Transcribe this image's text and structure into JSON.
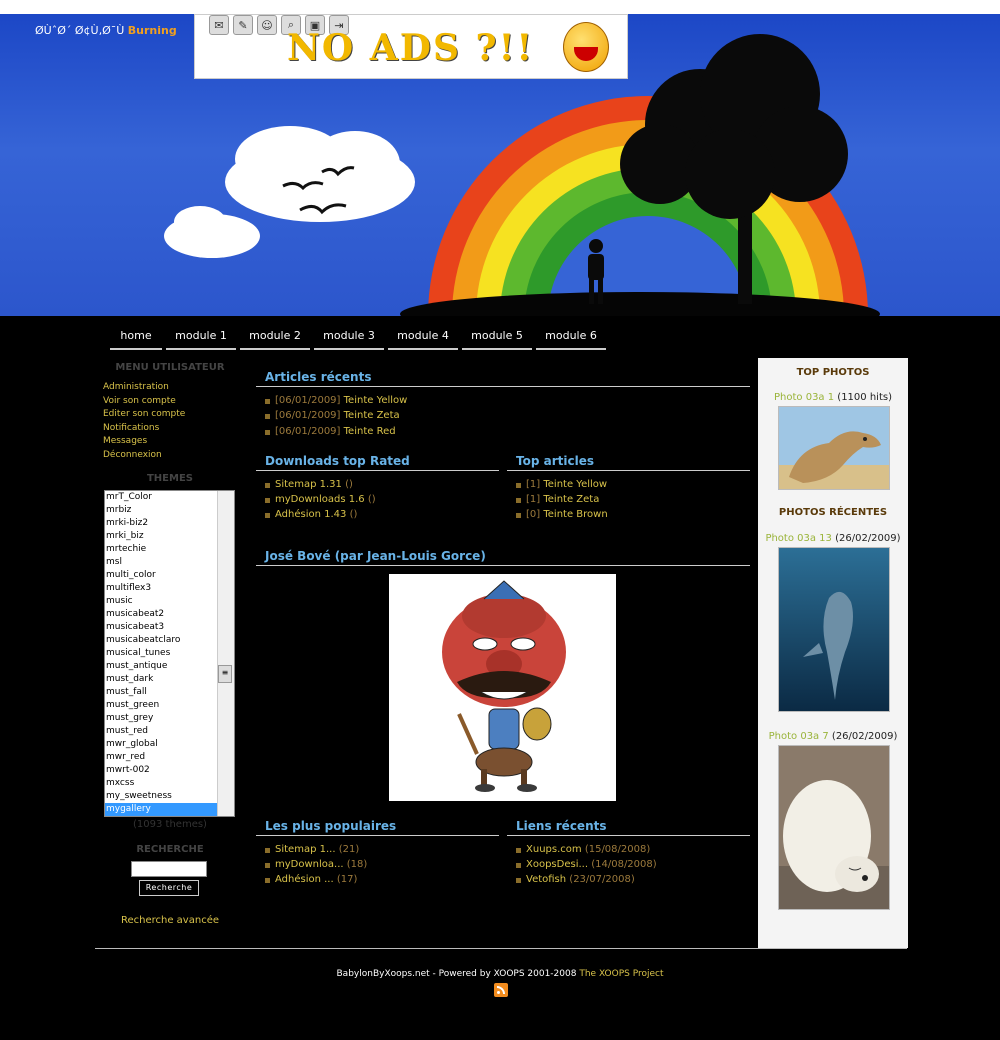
{
  "header": {
    "site_title": "ØÙˆØ´ØªÙ…ØˆÙˆØ¯ Burning",
    "site_title_prefix": "ØÙˆØ´ Ø¢Ù‚Ø¯Ù",
    "site_title_accent": "Burning",
    "ad_text": "NO ADS ?!!"
  },
  "nav": [
    "home",
    "module 1",
    "module 2",
    "module 3",
    "module 4",
    "module 5",
    "module 6"
  ],
  "left": {
    "user_menu_title": "MENU UTILISATEUR",
    "user_menu": [
      "Administration",
      "Voir son compte",
      "Editer son compte",
      "Notifications",
      "Messages",
      "Déconnexion"
    ],
    "themes_title": "THEMES",
    "themes": [
      "mrT_Color",
      "mrbiz",
      "mrki-biz2",
      "mrki_biz",
      "mrtechie",
      "msl",
      "multi_color",
      "multiflex3",
      "music",
      "musicabeat2",
      "musicabeat3",
      "musicabeatclaro",
      "musical_tunes",
      "must_antique",
      "must_dark",
      "must_fall",
      "must_green",
      "must_grey",
      "must_red",
      "mwr_global",
      "mwr_red",
      "mwrt-002",
      "mxcss",
      "my_sweetness",
      "mygallery"
    ],
    "selected_theme": "mygallery",
    "theme_count": "(1093 themes)",
    "search_title": "RECHERCHE",
    "search_button": "Recherche",
    "advanced_search": "Recherche avancée"
  },
  "main": {
    "recent_articles_title": "Articles récents",
    "recent_articles": [
      {
        "date": "[06/01/2009]",
        "title": "Teinte Yellow"
      },
      {
        "date": "[06/01/2009]",
        "title": "Teinte Zeta"
      },
      {
        "date": "[06/01/2009]",
        "title": "Teinte Red"
      }
    ],
    "downloads_title": "Downloads top Rated",
    "downloads": [
      {
        "name": "Sitemap 1.31",
        "extra": "()"
      },
      {
        "name": "myDownloads 1.6",
        "extra": "()"
      },
      {
        "name": "Adhésion 1.43",
        "extra": "()"
      }
    ],
    "top_articles_title": "Top articles",
    "top_articles": [
      {
        "count": "[1]",
        "title": "Teinte Yellow"
      },
      {
        "count": "[1]",
        "title": "Teinte Zeta"
      },
      {
        "count": "[0]",
        "title": "Teinte Brown"
      }
    ],
    "feature_title": "José Bové (par Jean-Louis Gorce)",
    "popular_title": "Les plus populaires",
    "popular": [
      {
        "name": "Sitemap 1...",
        "count": "(21)"
      },
      {
        "name": "myDownloa...",
        "count": "(18)"
      },
      {
        "name": "Adhésion ...",
        "count": "(17)"
      }
    ],
    "links_title": "Liens récents",
    "links": [
      {
        "name": "Xuups.com",
        "date": "(15/08/2008)"
      },
      {
        "name": "XoopsDesi...",
        "date": "(14/08/2008)"
      },
      {
        "name": "Vetofish",
        "date": "(23/07/2008)"
      }
    ]
  },
  "right": {
    "top_photos_title": "TOP PHOTOS",
    "top_photo": {
      "name": "Photo 03a 1",
      "extra": "(1100 hits)"
    },
    "recent_photos_title": "PHOTOS RÉCENTES",
    "recent_photos": [
      {
        "name": "Photo 03a 13",
        "date": "(26/02/2009)"
      },
      {
        "name": "Photo 03a 7",
        "date": "(26/02/2009)"
      }
    ]
  },
  "footer": {
    "text": "BabylonByXoops.net - Powered by XOOPS 2001-2008",
    "link": "The XOOPS Project"
  },
  "colors": {
    "accent_title": "#69b3e7",
    "link": "#d8c24a",
    "muted": "#9c7a3c"
  }
}
